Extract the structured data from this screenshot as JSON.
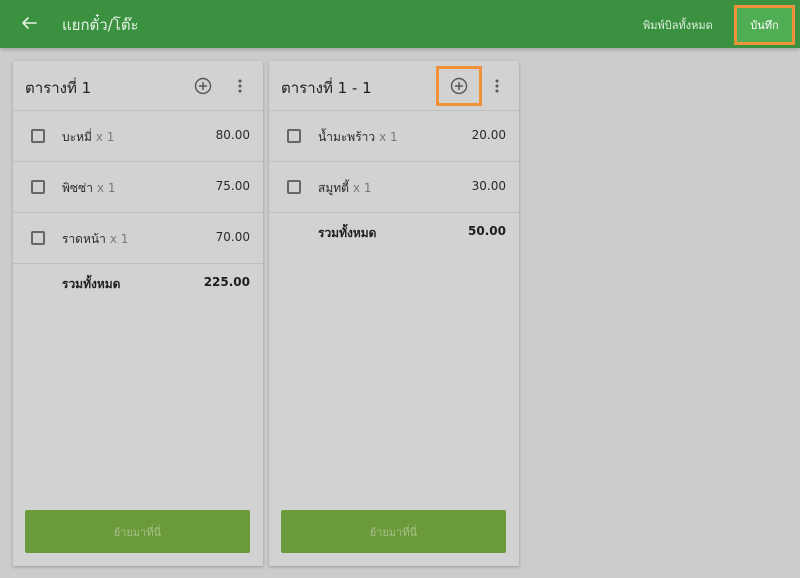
{
  "topbar": {
    "title": "แยกตั๋ว/โต๊ะ",
    "print_all": "พิมพ์บิลทั้งหมด",
    "save": "บันทึก",
    "back_icon": "arrow-left-icon",
    "bg_color": "#3a9240"
  },
  "panels": [
    {
      "title": "ตารางที่ 1",
      "items": [
        {
          "name": "บะหมี่",
          "qty": "x 1",
          "price": "80.00"
        },
        {
          "name": "พิซซ่า",
          "qty": "x 1",
          "price": "75.00"
        },
        {
          "name": "ราดหน้า",
          "qty": "x 1",
          "price": "70.00"
        }
      ],
      "total_label": "รวมทั้งหมด",
      "total_value": "225.00",
      "move_label": "ย้ายมาที่นี่"
    },
    {
      "title": "ตารางที่ 1 - 1",
      "items": [
        {
          "name": "น้ำมะพร้าว",
          "qty": "x 1",
          "price": "20.00"
        },
        {
          "name": "สมูทตี้",
          "qty": "x 1",
          "price": "30.00"
        }
      ],
      "total_label": "รวมทั้งหมด",
      "total_value": "50.00",
      "move_label": "ย้ายมาที่นี่"
    }
  ],
  "highlight_color": "#f0923a",
  "move_button_color": "#6b9a3a"
}
